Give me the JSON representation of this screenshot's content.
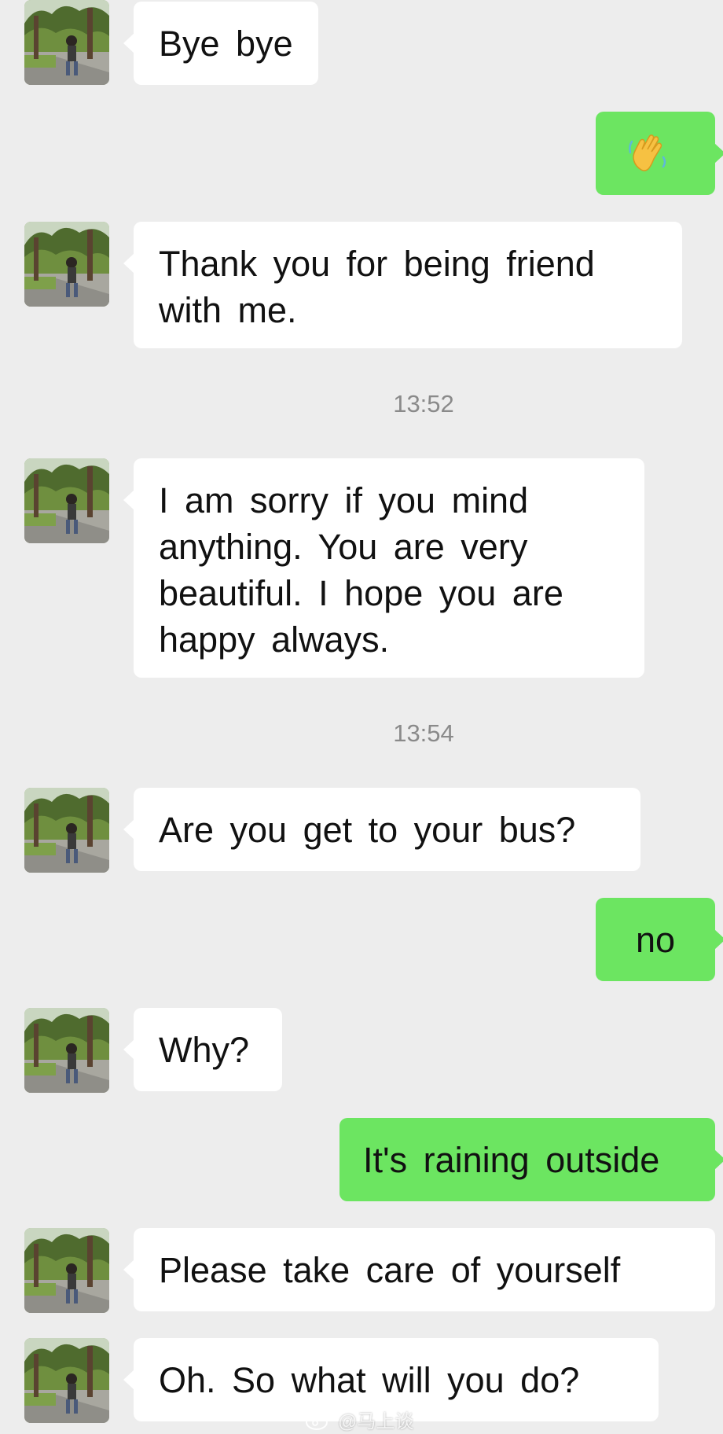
{
  "colors": {
    "background": "#ededed",
    "incoming_bubble": "#ffffff",
    "outgoing_bubble": "#6ce561",
    "timestamp_text": "#8a8a8a"
  },
  "messages": [
    {
      "from": "contact",
      "text": "Bye bye"
    },
    {
      "from": "me",
      "emoji": "waving-hand-icon"
    },
    {
      "from": "contact",
      "text": "Thank you for being friend with me."
    },
    {
      "timestamp": "13:52"
    },
    {
      "from": "contact",
      "text": "I am sorry if you mind anything. You are very beautiful. I hope you are happy always."
    },
    {
      "timestamp": "13:54"
    },
    {
      "from": "contact",
      "text": "Are you get to your bus?"
    },
    {
      "from": "me",
      "text": "no"
    },
    {
      "from": "contact",
      "text": "Why?"
    },
    {
      "from": "me",
      "text": "It's raining outside"
    },
    {
      "from": "contact",
      "text": "Please take care of yourself"
    },
    {
      "from": "contact",
      "text": "Oh. So what will you do?"
    }
  ],
  "watermark": {
    "handle": "@马上谈",
    "icon": "weibo-icon"
  }
}
